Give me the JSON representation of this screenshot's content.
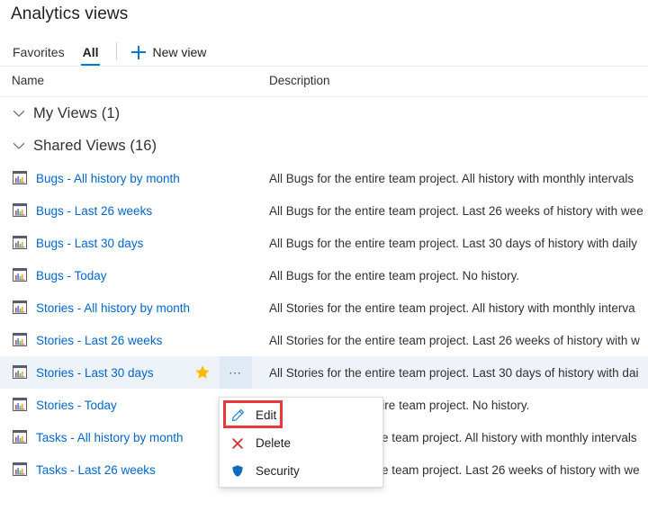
{
  "page": {
    "title": "Analytics views"
  },
  "command_bar": {
    "tabs": [
      {
        "label": "Favorites",
        "selected": false
      },
      {
        "label": "All",
        "selected": true
      }
    ],
    "new_view_label": "New view",
    "new_view_icon": "plus-icon",
    "accent_color": "#0078d4"
  },
  "list": {
    "columns": {
      "name": "Name",
      "description": "Description"
    },
    "link_color": "#0066cc",
    "selection_color": "#edf3f9",
    "groups": [
      {
        "label": "My Views (1)",
        "expanded": true,
        "chevron_icon": "chevron-down-icon",
        "rows": []
      },
      {
        "label": "Shared Views (16)",
        "expanded": true,
        "chevron_icon": "chevron-down-icon",
        "rows": [
          {
            "icon": "chart-report-icon",
            "name": "Bugs - All history by month",
            "description": "All Bugs for the entire team project. All history with monthly intervals",
            "selected": false
          },
          {
            "icon": "chart-report-icon",
            "name": "Bugs - Last 26 weeks",
            "description": "All Bugs for the entire team project. Last 26 weeks of history with wee",
            "selected": false
          },
          {
            "icon": "chart-report-icon",
            "name": "Bugs - Last 30 days",
            "description": "All Bugs for the entire team project. Last 30 days of history with daily",
            "selected": false
          },
          {
            "icon": "chart-report-icon",
            "name": "Bugs - Today",
            "description": "All Bugs for the entire team project. No history.",
            "selected": false
          },
          {
            "icon": "chart-report-icon",
            "name": "Stories - All history by month",
            "description": "All Stories for the entire team project. All history with monthly interva",
            "selected": false
          },
          {
            "icon": "chart-report-icon",
            "name": "Stories - Last 26 weeks",
            "description": "All Stories for the entire team project. Last 26 weeks of history with w",
            "selected": false
          },
          {
            "icon": "chart-report-icon",
            "name": "Stories - Last 30 days",
            "description": "All Stories for the entire team project. Last 30 days of history with dai",
            "selected": true,
            "favorite": true,
            "star_icon": "star-filled-icon",
            "more_icon": "ellipsis-icon",
            "more_label": "⋯"
          },
          {
            "icon": "chart-report-icon",
            "name": "Stories - Today",
            "description": "All Stories for the entire team project. No history.",
            "selected": false
          },
          {
            "icon": "chart-report-icon",
            "name": "Tasks - All history by month",
            "description": "All Tasks for the entire team project. All history with monthly intervals",
            "selected": false
          },
          {
            "icon": "chart-report-icon",
            "name": "Tasks - Last 26 weeks",
            "description": "All Tasks for the entire team project. Last 26 weeks of history with we",
            "selected": false
          }
        ]
      }
    ]
  },
  "context_menu": {
    "items": [
      {
        "label": "Edit",
        "icon": "pencil-icon",
        "icon_color": "#0078d4",
        "highlighted": true
      },
      {
        "label": "Delete",
        "icon": "cross-icon",
        "icon_color": "#d13438",
        "highlighted": false
      },
      {
        "label": "Security",
        "icon": "shield-icon",
        "icon_color": "#0078d4",
        "highlighted": false
      }
    ]
  },
  "annotation": {
    "color": "#e8383d",
    "target": "Edit"
  }
}
